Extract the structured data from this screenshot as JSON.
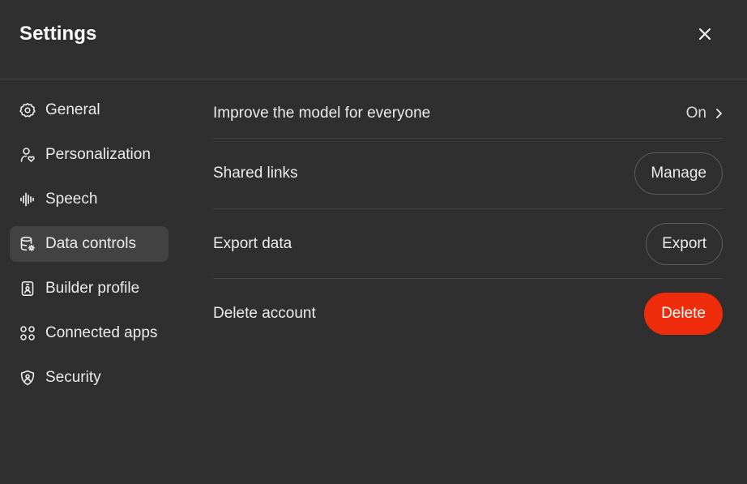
{
  "header": {
    "title": "Settings",
    "close_icon": "close-icon"
  },
  "sidebar": {
    "items": [
      {
        "label": "General",
        "icon": "gear-icon",
        "active": false
      },
      {
        "label": "Personalization",
        "icon": "person-heart-icon",
        "active": false
      },
      {
        "label": "Speech",
        "icon": "waveform-icon",
        "active": false
      },
      {
        "label": "Data controls",
        "icon": "database-gear-icon",
        "active": true
      },
      {
        "label": "Builder profile",
        "icon": "id-badge-icon",
        "active": false
      },
      {
        "label": "Connected apps",
        "icon": "apps-grid-icon",
        "active": false
      },
      {
        "label": "Security",
        "icon": "shield-icon",
        "active": false
      }
    ]
  },
  "data_controls": {
    "improve_model": {
      "label": "Improve the model for everyone",
      "value": "On"
    },
    "shared_links": {
      "label": "Shared links",
      "button": "Manage"
    },
    "export_data": {
      "label": "Export data",
      "button": "Export"
    },
    "delete_account": {
      "label": "Delete account",
      "button": "Delete"
    }
  },
  "colors": {
    "background": "#2f2f2f",
    "active_item": "#424242",
    "danger": "#ef2c0b",
    "divider": "#444444"
  }
}
